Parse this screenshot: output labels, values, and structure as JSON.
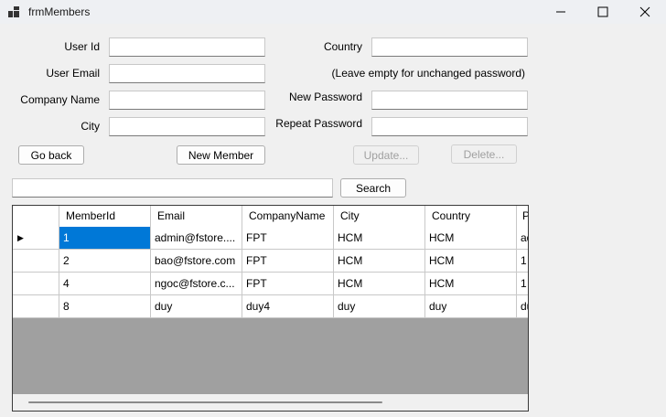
{
  "window": {
    "title": "frmMembers"
  },
  "form": {
    "user_id": {
      "label": "User Id",
      "value": ""
    },
    "user_email": {
      "label": "User Email",
      "value": ""
    },
    "company_name": {
      "label": "Company Name",
      "value": ""
    },
    "city": {
      "label": "City",
      "value": ""
    },
    "country": {
      "label": "Country",
      "value": ""
    },
    "password_hint": "(Leave empty for unchanged password)",
    "new_password": {
      "label": "New Password",
      "value": ""
    },
    "repeat_password": {
      "label": "Repeat Password",
      "value": ""
    }
  },
  "buttons": {
    "go_back": "Go back",
    "new_member": "New Member",
    "update": "Update...",
    "delete": "Delete...",
    "search": "Search"
  },
  "search": {
    "value": ""
  },
  "grid": {
    "columns": [
      "MemberId",
      "Email",
      "CompanyName",
      "City",
      "Country",
      "P"
    ],
    "rows": [
      [
        "1",
        "admin@fstore....",
        "FPT",
        "HCM",
        "HCM",
        "ad"
      ],
      [
        "2",
        "bao@fstore.com",
        "FPT",
        "HCM",
        "HCM",
        "1"
      ],
      [
        "4",
        "ngoc@fstore.c...",
        "FPT",
        "HCM",
        "HCM",
        "1"
      ],
      [
        "8",
        "duy",
        "duy4",
        "duy",
        "duy",
        "du"
      ]
    ],
    "current_row_indicator": "▶"
  },
  "icons": {
    "app": "app-icon",
    "minimize": "minimize-icon",
    "maximize": "maximize-icon",
    "close": "close-icon",
    "row_pointer": "row-pointer-icon"
  }
}
